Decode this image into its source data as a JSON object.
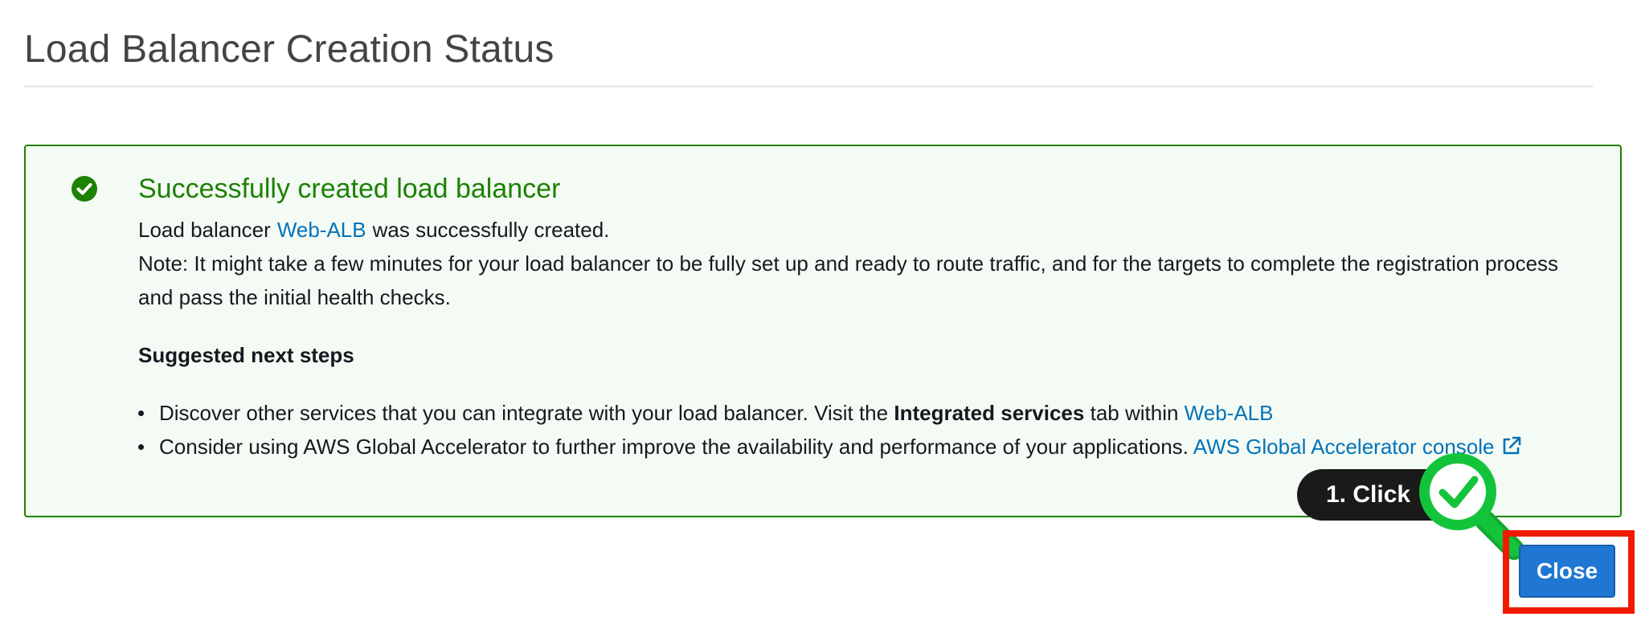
{
  "page": {
    "title": "Load Balancer Creation Status"
  },
  "alert": {
    "status": "success",
    "icon": "check-circle-icon",
    "title": "Successfully created load balancer",
    "message_prefix": "Load balancer",
    "load_balancer_name": "Web-ALB",
    "message_suffix": "was successfully created.",
    "note": "Note: It might take a few minutes for your load balancer to be fully set up and ready to route traffic, and for the targets to complete the registration process and pass the initial health checks.",
    "next_steps_heading": "Suggested next steps",
    "steps": [
      {
        "text_before": "Discover other services that you can integrate with your load balancer. Visit the",
        "bold_text": "Integrated services",
        "text_after": "tab within",
        "link_text": "Web-ALB"
      },
      {
        "text_before": "Consider using AWS Global Accelerator to further improve the availability and performance of your applications.",
        "link_text": "AWS Global Accelerator console",
        "link_icon": "external-link-icon"
      }
    ]
  },
  "annotation": {
    "tooltip_text": "1. Click",
    "icon": "magnifier-check-icon"
  },
  "footer": {
    "close_label": "Close"
  },
  "colors": {
    "success_green": "#1d8102",
    "success_bg": "#f4fbf4",
    "link_blue": "#0073bb",
    "primary_button": "#1f76d3",
    "highlight_red": "#f21b00",
    "annotation_green": "#12c23a"
  }
}
